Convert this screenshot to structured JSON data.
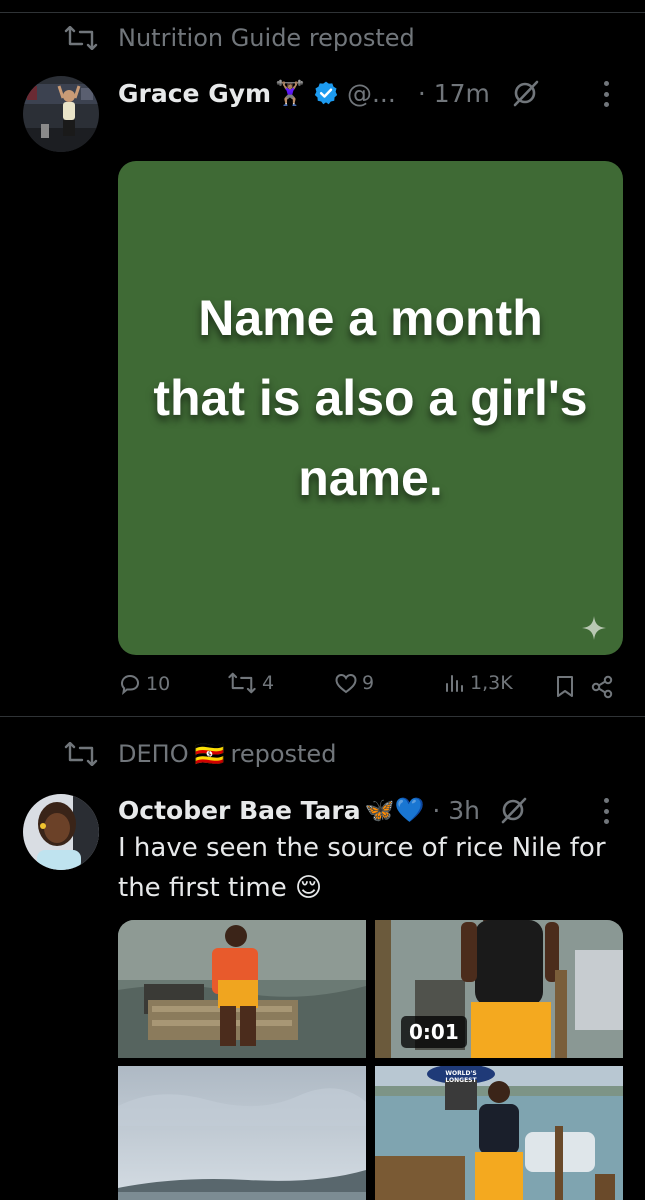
{
  "post1": {
    "repost_label": "Nutrition Guide reposted",
    "author_name": "Grace Gym",
    "author_emoji": "🏋🏽‍♀️",
    "handle": "@...",
    "time": "· 17m",
    "image_text": "Name a month that is also a girl's name.",
    "stats": {
      "replies": "10",
      "reposts": "4",
      "likes": "9",
      "views": "1,3K"
    }
  },
  "post2": {
    "repost_user": "DEПO",
    "repost_flag": "🇺🇬",
    "repost_suffix": "reposted",
    "author_name": "October Bae Tara",
    "author_emoji": "🦋💙",
    "time": "· 3h",
    "text": "I have seen the source of rice Nile for the first  time 😌",
    "video_duration": "0:01",
    "sign_text": "WORLD'S LONGEST"
  },
  "colors": {
    "background": "#000000",
    "secondary_text": "#71767b",
    "verified_blue": "#1d9bf0",
    "card_green": "#3f6a35"
  },
  "icons": [
    "repost-icon",
    "verified-badge-icon",
    "grok-icon",
    "more-icon",
    "reply-icon",
    "like-icon",
    "views-icon",
    "bookmark-icon",
    "share-icon",
    "sparkle-icon"
  ]
}
